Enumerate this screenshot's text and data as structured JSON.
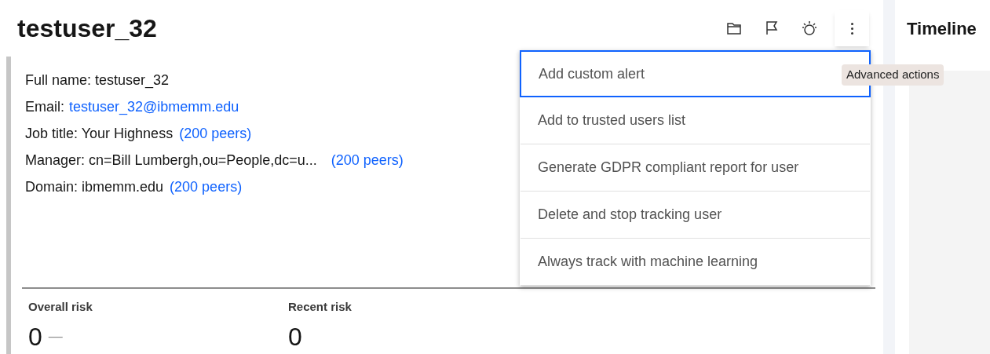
{
  "title": "testuser_32",
  "toolbar": {
    "more_tooltip": "Advanced actions"
  },
  "details": [
    {
      "label": "Full name:",
      "value": "testuser_32",
      "kind": "plain"
    },
    {
      "label": "Email:",
      "value": "testuser_32@ibmemm.edu",
      "kind": "link"
    },
    {
      "label": "Job title:",
      "value": "Your Highness",
      "kind": "peers",
      "peers": "(200 peers)"
    },
    {
      "label": "Manager:",
      "value": "cn=Bill Lumbergh,ou=People,dc=u...",
      "kind": "peers",
      "peers": "(200 peers)"
    },
    {
      "label": "Domain:",
      "value": "ibmemm.edu",
      "kind": "peers",
      "peers": "(200 peers)"
    }
  ],
  "menu": [
    {
      "label": "Add custom alert",
      "selected": true
    },
    {
      "label": "Add to trusted users list",
      "selected": false
    },
    {
      "label": "Generate GDPR compliant report for user",
      "selected": false
    },
    {
      "label": "Delete and stop tracking user",
      "selected": false
    },
    {
      "label": "Always track with machine learning",
      "selected": false
    }
  ],
  "risks": [
    {
      "label": "Overall risk",
      "value": "0",
      "trend": "—"
    },
    {
      "label": "Recent risk",
      "value": "0"
    }
  ],
  "timeline": {
    "title": "Timeline"
  }
}
